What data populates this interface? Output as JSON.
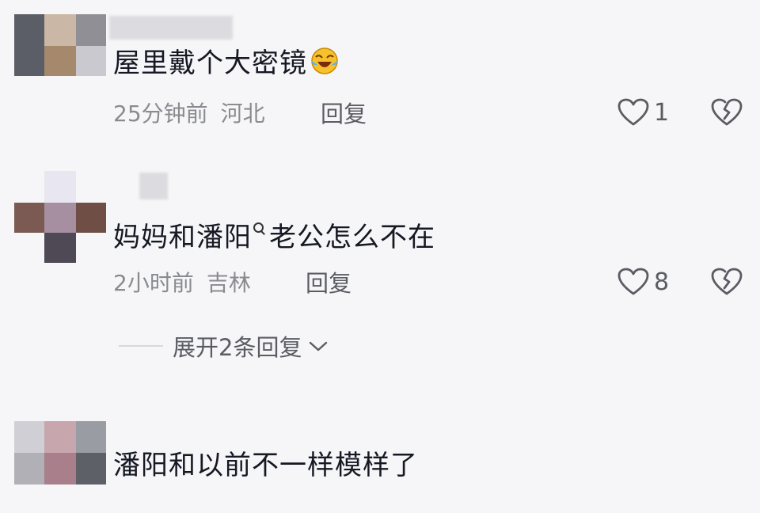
{
  "comments": [
    {
      "text": "屋里戴个大密镜",
      "emoji": "laughing-crying-emoji",
      "time": "25分钟前",
      "location": "河北",
      "reply_label": "回复",
      "likes": "1"
    },
    {
      "text_prefix": "妈妈和",
      "mention": "潘阳",
      "text_suffix": "老公怎么不在",
      "time": "2小时前",
      "location": "吉林",
      "reply_label": "回复",
      "likes": "8",
      "expand_label": "展开2条回复"
    },
    {
      "text": "潘阳和以前不一样模样了"
    }
  ],
  "colors": {
    "background": "#f6f6f8",
    "text": "#161823",
    "meta": "#8a8b91",
    "icon": "#5b5c63"
  }
}
